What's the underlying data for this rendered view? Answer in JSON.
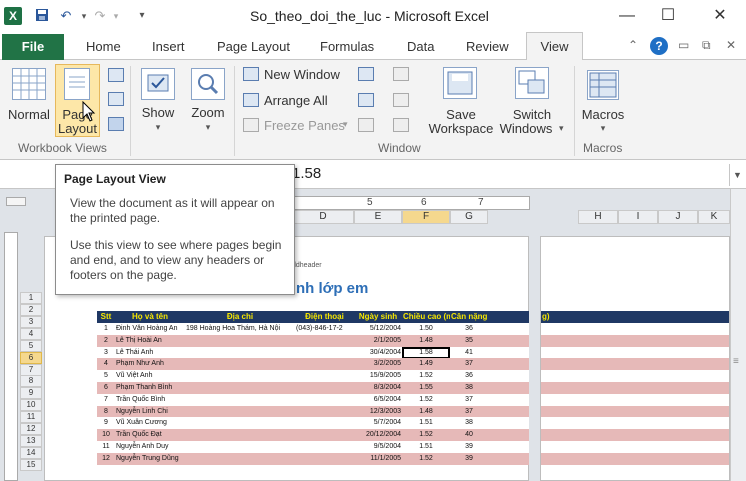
{
  "window": {
    "title": "So_theo_doi_the_luc - Microsoft Excel",
    "app_icon": "excel-icon",
    "minimize": "—",
    "maximize": "☐",
    "close": "✕"
  },
  "quick_access": [
    "save-icon",
    "undo-icon",
    "redo-icon",
    "customize-icon"
  ],
  "tabs": {
    "file": "File",
    "items": [
      "Home",
      "Insert",
      "Page Layout",
      "Formulas",
      "Data",
      "Review"
    ],
    "active": "View"
  },
  "ribbon": {
    "workbook_views": {
      "normal": "Normal",
      "page_layout_line1": "Page",
      "page_layout_line2": "Layout",
      "group": "Workbook Views"
    },
    "show": "Show",
    "zoom": "Zoom",
    "window": {
      "new_window": "New Window",
      "arrange_all": "Arrange All",
      "freeze_panes": "Freeze Panes",
      "save_workspace_line1": "Save",
      "save_workspace_line2": "Workspace",
      "switch_windows_line1": "Switch",
      "switch_windows_line2": "Windows",
      "group": "Window"
    },
    "macros": {
      "label": "Macros",
      "group": "Macros"
    }
  },
  "formula_bar": {
    "value": "1.58"
  },
  "tooltip": {
    "title": "Page Layout View",
    "p1": "View the document as it will appear on the printed page.",
    "p2": "Use this view to see where pages begin and end, and to view any headers or footers on the page."
  },
  "sheet": {
    "columns_left": [
      "D",
      "E",
      "F",
      "G"
    ],
    "columns_right": [
      "H",
      "I",
      "J",
      "K"
    ],
    "ruler_numbers": [
      "5",
      "6",
      "7"
    ],
    "header_placeholder": "ddheader",
    "title_partial": "nh lớp em",
    "row_numbers": [
      "1",
      "2",
      "3",
      "4",
      "5",
      "6",
      "7",
      "8",
      "9",
      "10",
      "11",
      "12",
      "13",
      "14",
      "15"
    ],
    "table_header": [
      "Stt",
      "Họ và tên",
      "Địa chỉ",
      "Điện thoại",
      "Ngày sinh",
      "Chiều cao (m)",
      "Cân nặng (kg)"
    ],
    "right_header_fragment": "g)",
    "rows": [
      [
        "1",
        "Đinh Văn Hoàng An",
        "198 Hoàng Hoa Thám, Hà Nội",
        "(043)-846-17-2",
        "5/12/2004",
        "1.50",
        "36"
      ],
      [
        "2",
        "Lê Thị Hoài An",
        "",
        "",
        "2/1/2005",
        "1.48",
        "35"
      ],
      [
        "3",
        "Lê Thái Anh",
        "",
        "",
        "30/4/2004",
        "1.58",
        "41"
      ],
      [
        "4",
        "Phạm Như Anh",
        "",
        "",
        "3/2/2005",
        "1.49",
        "37"
      ],
      [
        "5",
        "Vũ Việt Anh",
        "",
        "",
        "15/9/2005",
        "1.52",
        "36"
      ],
      [
        "6",
        "Phạm Thanh Bình",
        "",
        "",
        "8/3/2004",
        "1.55",
        "38"
      ],
      [
        "7",
        "Trần Quốc Bình",
        "",
        "",
        "6/5/2004",
        "1.52",
        "37"
      ],
      [
        "8",
        "Nguyễn Linh Chi",
        "",
        "",
        "12/3/2003",
        "1.48",
        "37"
      ],
      [
        "9",
        "Vũ Xuân Cương",
        "",
        "",
        "5/7/2004",
        "1.51",
        "38"
      ],
      [
        "10",
        "Trần Quốc Đạt",
        "",
        "",
        "20/12/2004",
        "1.52",
        "40"
      ],
      [
        "11",
        "Nguyễn Anh Duy",
        "",
        "",
        "9/5/2004",
        "1.51",
        "39"
      ],
      [
        "12",
        "Nguyễn Trung Dũng",
        "",
        "",
        "11/1/2005",
        "1.52",
        "39"
      ]
    ]
  },
  "colors": {
    "file_tab": "#217346",
    "table_header_bg": "#1f3864",
    "table_header_text": "#f5e600",
    "stripe": "#e6b9b8"
  }
}
